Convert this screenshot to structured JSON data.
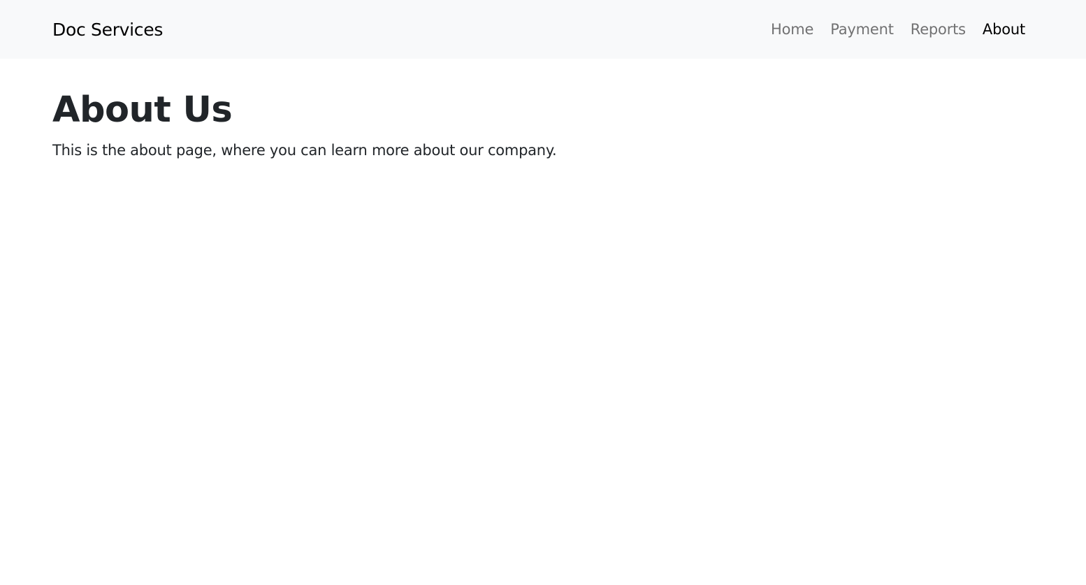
{
  "navbar": {
    "brand": "Doc Services",
    "links": [
      {
        "label": "Home",
        "active": false
      },
      {
        "label": "Payment",
        "active": false
      },
      {
        "label": "Reports",
        "active": false
      },
      {
        "label": "About",
        "active": true
      }
    ]
  },
  "main": {
    "title": "About Us",
    "description": "This is the about page, where you can learn more about our company."
  },
  "colors": {
    "navbar_bg": "#f8f9fa",
    "text": "#212529",
    "nav_link": "#8c8c8c",
    "nav_link_active": "#000000"
  }
}
